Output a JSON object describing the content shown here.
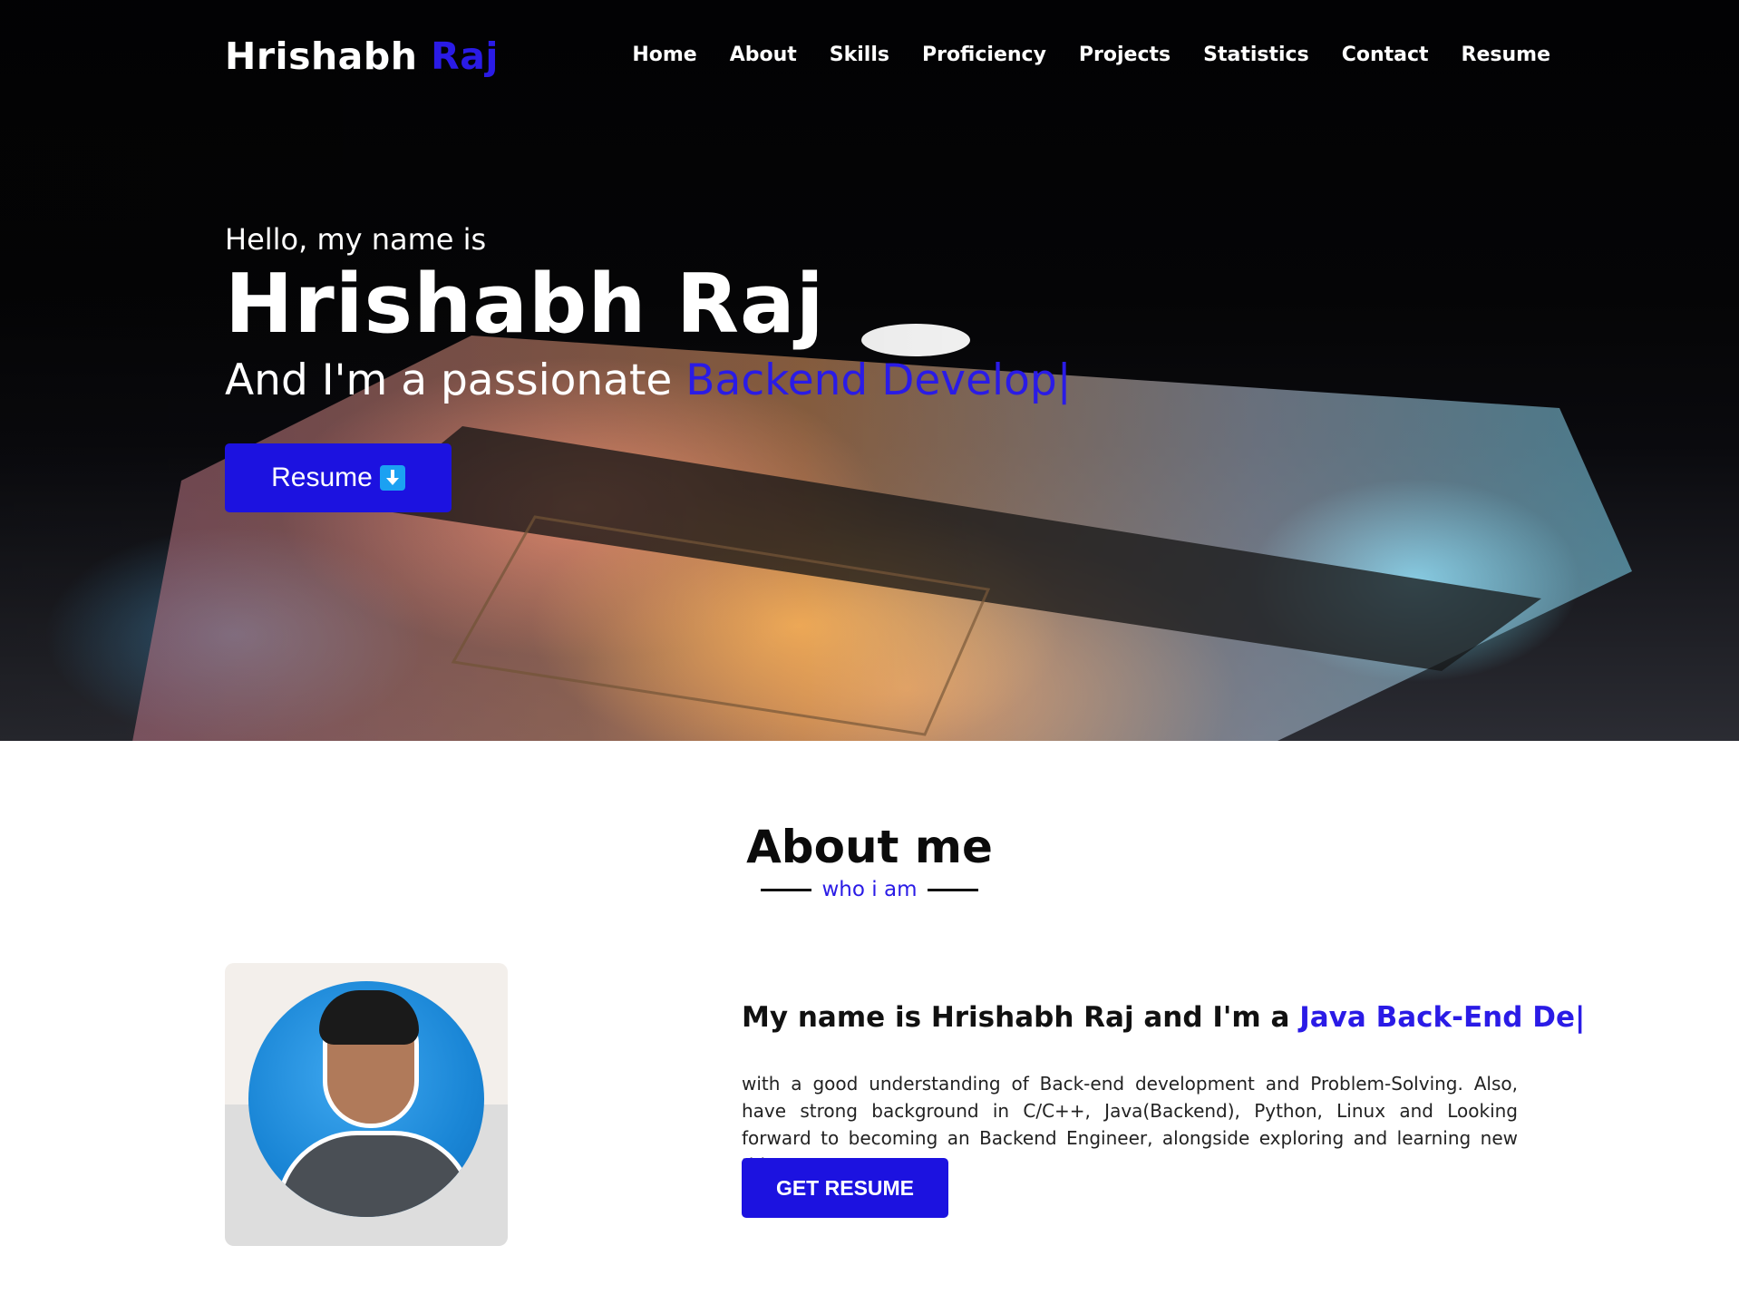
{
  "navbar": {
    "brand_first": "Hrishabh",
    "brand_second": "Raj",
    "links": [
      "Home",
      "About",
      "Skills",
      "Proficiency",
      "Projects",
      "Statistics",
      "Contact",
      "Resume"
    ]
  },
  "hero": {
    "greeting": "Hello, my name is",
    "name": "Hrishabh Raj",
    "line_prefix": "And I'm a passionate",
    "typed_text": "Backend Develop",
    "cursor": "|",
    "button_label": "Resume",
    "button_icon": "download-arrow-icon"
  },
  "about": {
    "title": "About me",
    "subtitle": "who i am",
    "heading_prefix": "My name is Hrishabh Raj and I'm a",
    "heading_typed": "Java Back-End De",
    "heading_cursor": "|",
    "description": "with a good understanding of Back-end development and Problem-Solving. Also, have strong background in C/C++, Java(Backend), Python, Linux and Looking forward to becoming an Backend Engineer, alongside exploring and learning new things.",
    "button_label": "GET RESUME"
  },
  "colors": {
    "accent": "#2a1be6",
    "button": "#1c12e0",
    "hero_bg": "#050506"
  }
}
